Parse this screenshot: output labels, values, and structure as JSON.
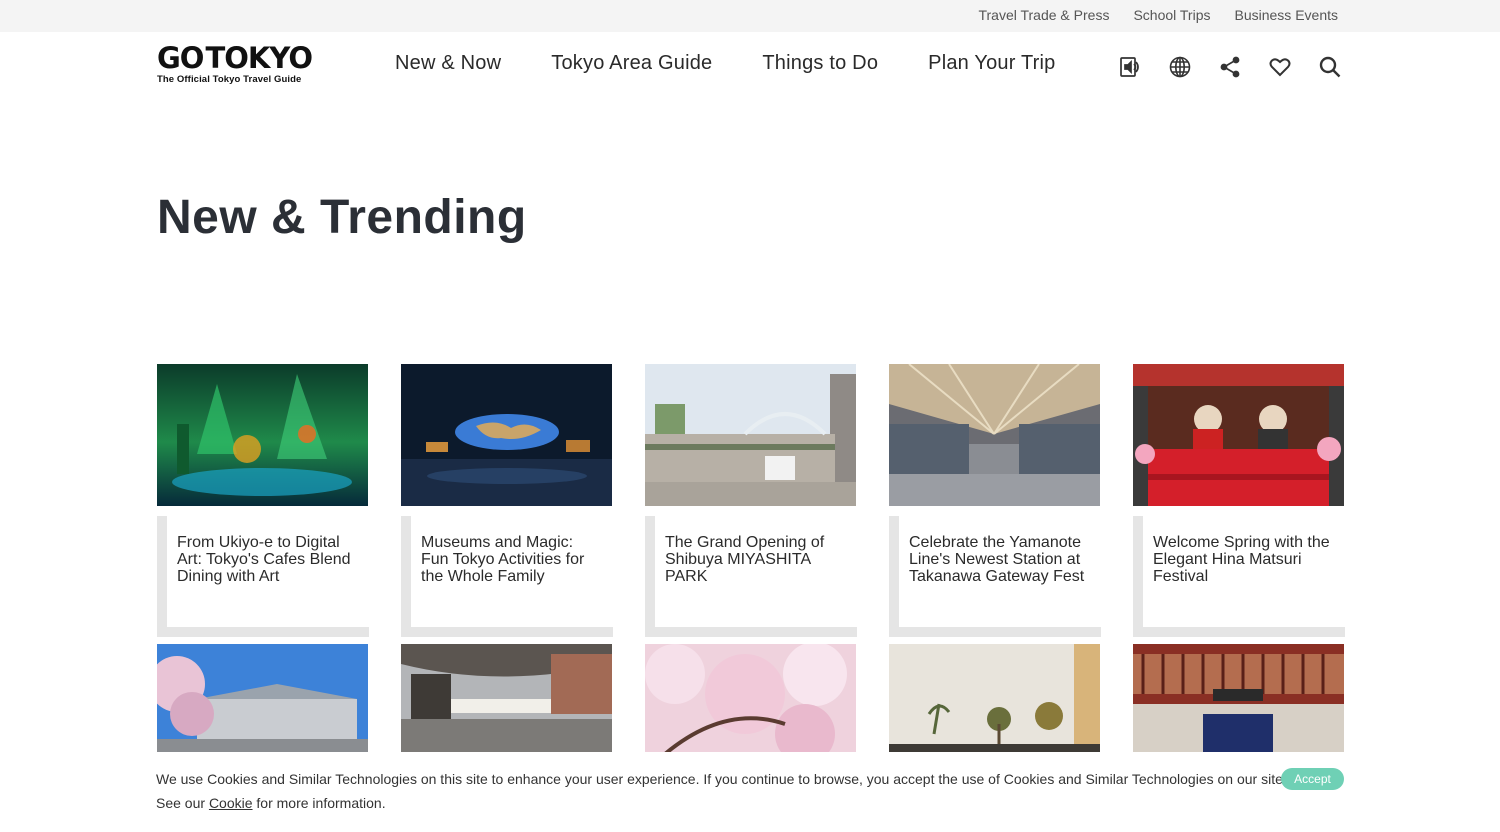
{
  "topbar": {
    "links": [
      "Travel Trade & Press",
      "School Trips",
      "Business Events"
    ]
  },
  "logo": {
    "main_left": "GO",
    "main_right": "TOKYO",
    "tagline": "The Official Tokyo Travel Guide"
  },
  "nav": {
    "items": [
      "New & Now",
      "Tokyo Area Guide",
      "Things to Do",
      "Plan Your Trip"
    ]
  },
  "header_icons": [
    "audio-guide-icon",
    "globe-icon",
    "share-icon",
    "heart-icon",
    "search-icon"
  ],
  "page": {
    "title": "New & Trending"
  },
  "cards_row1": [
    {
      "title": "From Ukiyo-e to Digital Art: Tokyo's Cafes Blend Dining with Art"
    },
    {
      "title": "Museums and Magic: Fun Tokyo Activities for the Whole Family"
    },
    {
      "title": "The Grand Opening of Shibuya MIYASHITA PARK"
    },
    {
      "title": "Celebrate the Yamanote Line's Newest Station at Takanawa Gateway Fest"
    },
    {
      "title": "Welcome Spring with the Elegant Hina Matsuri Festival"
    }
  ],
  "cookie": {
    "line1": "We use Cookies and Similar Technologies on this site to enhance your user experience. If you continue to browse, you accept the use of Cookies and Similar Technologies on our site.",
    "line2_before": "See our ",
    "line2_link": "Cookie",
    "line2_after": " for more information.",
    "accept_label": "Accept"
  },
  "colors": {
    "accent": "#6fd0b5",
    "caption_border": "#e5e5e5",
    "topbar_bg": "#f4f4f4"
  }
}
